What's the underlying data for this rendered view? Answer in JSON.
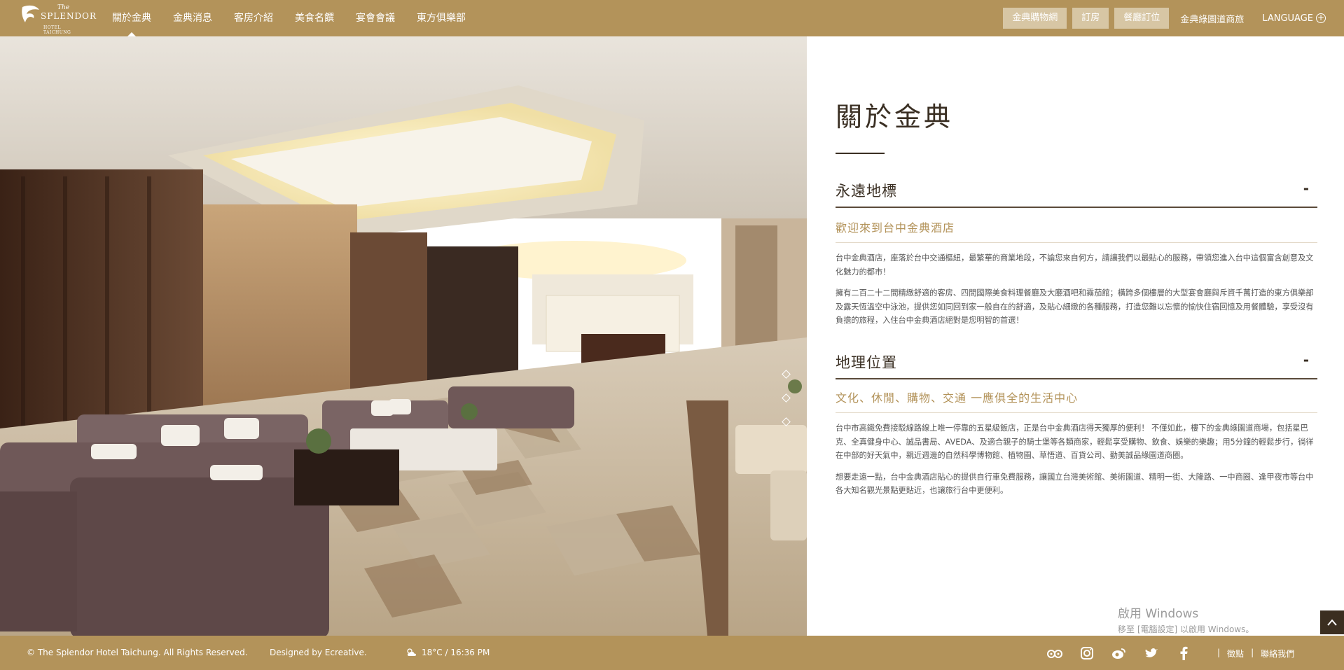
{
  "header": {
    "logo": {
      "the": "The",
      "name": "SPLENDOR",
      "city": "HOTEL TAICHUNG"
    },
    "nav": [
      {
        "label": "關於金典"
      },
      {
        "label": "金典消息"
      },
      {
        "label": "客房介紹"
      },
      {
        "label": "美食名饌"
      },
      {
        "label": "宴會會議"
      },
      {
        "label": "東方俱樂部"
      }
    ],
    "buttons": [
      {
        "label": "金典購物網"
      },
      {
        "label": "訂房"
      },
      {
        "label": "餐廳訂位"
      }
    ],
    "link": "金典綠園道商旅",
    "language": "LANGUAGE",
    "language_icon": "plus-circle-icon"
  },
  "content": {
    "title": "關於金典",
    "sections": [
      {
        "heading": "永遠地標",
        "toggle": "-",
        "subheading": "歡迎來到台中金典酒店",
        "paragraphs": [
          "台中金典酒店，座落於台中交通樞紐，最繁華的商業地段，不論您來自何方，請讓我們以最貼心的服務，帶領您進入台中這個富含創意及文化魅力的都市！",
          "擁有二百二十二間精緻舒適的客房、四間國際美食料理餐廳及大廳酒吧和霧茄館；橫跨多個樓層的大型宴會廳與斥資千萬打造的東方俱樂部及露天恆溫空中泳池，提供您如同回到家一般自在的舒適，及貼心細緻的各種服務，打造您難以忘懷的愉快住宿回憶及用餐體驗，享受沒有負擔的旅程，入住台中金典酒店絕對是您明智的首選！"
        ]
      },
      {
        "heading": "地理位置",
        "toggle": "-",
        "subheading": "文化、休閒、購物、交通 一應俱全的生活中心",
        "paragraphs": [
          "台中市高鐵免費接駁線路線上唯一停靠的五星級飯店，正是台中金典酒店得天獨厚的便利！ 不僅如此，樓下的金典綠園道商場，包括星巴克、全真健身中心、誠品書局、AVEDA、及適合親子的騎士堡等各類商家，輕鬆享受購物、飲食、娛樂的樂趣；用5分鐘的輕鬆步行，徜徉在中部的好天氣中，親近週邊的自然科學博物館、植物園、草悟道、百貨公司、勤美誠品綠園道商圈。",
          "想要走遠一點，台中金典酒店貼心的提供自行車免費服務，讓國立台灣美術館、美術園道、精明一街、大隆路、一中商圈、逢甲夜市等台中各大知名觀光景點更貼近，也讓旅行台中更便利。"
        ]
      }
    ]
  },
  "watermark": {
    "line1": "啟用 Windows",
    "line2": "移至 [電腦設定] 以啟用 Windows。"
  },
  "scroll_top_icon": "chevron-up-icon",
  "footer": {
    "copyright": "© The Splendor Hotel Taichung. All Rights Reserved.",
    "designed": "Designed by Ecreative.",
    "weather": "18°C / 16:36 PM",
    "weather_icon": "partly-cloudy-icon",
    "social": [
      "tripadvisor-icon",
      "instagram-icon",
      "weibo-icon",
      "twitter-icon",
      "facebook-icon"
    ],
    "links": [
      "|",
      "徵點",
      "|",
      "聯絡我們"
    ]
  },
  "colors": {
    "gold": "#b3935a",
    "gold_light": "#d7c6a4",
    "dark_brown": "#3a2f23"
  }
}
